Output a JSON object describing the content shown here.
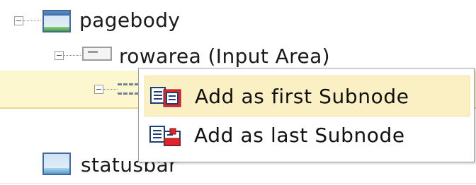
{
  "tree": {
    "nodes": [
      {
        "label": "pagebody",
        "icon": "window-icon"
      },
      {
        "label": "rowarea (Input Area)",
        "icon": "input-area-icon"
      },
      {
        "label": "",
        "icon": "dashed-area-icon"
      },
      {
        "label": "statusbar",
        "icon": "statusbar-window-icon"
      }
    ]
  },
  "context_menu": {
    "items": [
      {
        "label": "Add as first Subnode",
        "icon": "add-first-subnode-icon",
        "active": true
      },
      {
        "label": "Add as last Subnode",
        "icon": "add-last-subnode-icon",
        "active": false
      }
    ]
  },
  "colors": {
    "highlight_row": "#fdf7cf",
    "menu_hover": "#fbf0c4",
    "icon_blue": "#3d6aa3",
    "icon_green": "#4c9d3a",
    "icon_red": "#e0242a"
  }
}
